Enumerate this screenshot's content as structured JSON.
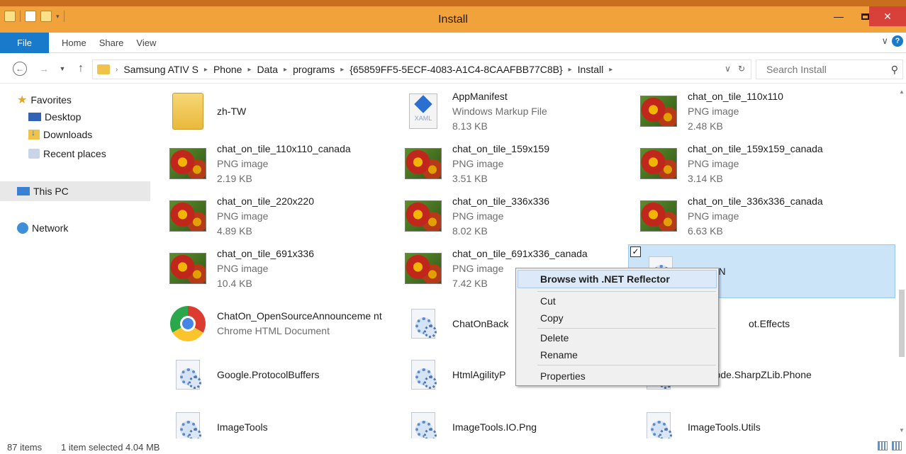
{
  "window": {
    "title": "Install"
  },
  "ribbon": {
    "tabs": [
      "File",
      "Home",
      "Share",
      "View"
    ]
  },
  "address": {
    "crumbs": [
      "Samsung ATIV S",
      "Phone",
      "Data",
      "programs",
      "{65859FF5-5ECF-4083-A1C4-8CAAFBB77C8B}",
      "Install"
    ],
    "search_placeholder": "Search Install"
  },
  "nav": {
    "favorites": "Favorites",
    "desktop": "Desktop",
    "downloads": "Downloads",
    "recent": "Recent places",
    "this_pc": "This PC",
    "network": "Network"
  },
  "files": [
    {
      "name": "zh-TW",
      "type": "",
      "size": "",
      "icon": "folder-icon"
    },
    {
      "name": "AppManifest",
      "type": "Windows Markup File",
      "size": "8.13 KB",
      "icon": "xaml-file-icon"
    },
    {
      "name": "chat_on_tile_110x110",
      "type": "PNG image",
      "size": "2.48 KB",
      "icon": "png-image-icon"
    },
    {
      "name": "chat_on_tile_110x110_canada",
      "type": "PNG image",
      "size": "2.19 KB",
      "icon": "png-image-icon"
    },
    {
      "name": "chat_on_tile_159x159",
      "type": "PNG image",
      "size": "3.51 KB",
      "icon": "png-image-icon"
    },
    {
      "name": "chat_on_tile_159x159_canada",
      "type": "PNG image",
      "size": "3.14 KB",
      "icon": "png-image-icon"
    },
    {
      "name": "chat_on_tile_220x220",
      "type": "PNG image",
      "size": "4.89 KB",
      "icon": "png-image-icon"
    },
    {
      "name": "chat_on_tile_336x336",
      "type": "PNG image",
      "size": "8.02 KB",
      "icon": "png-image-icon"
    },
    {
      "name": "chat_on_tile_336x336_canada",
      "type": "PNG image",
      "size": "6.63 KB",
      "icon": "png-image-icon"
    },
    {
      "name": "chat_on_tile_691x336",
      "type": "PNG image",
      "size": "10.4 KB",
      "icon": "png-image-icon"
    },
    {
      "name": "chat_on_tile_691x336_canada",
      "type": "PNG image",
      "size": "7.42 KB",
      "icon": "png-image-icon"
    },
    {
      "name": "ChatON",
      "type": "",
      "size": "",
      "icon": "dll-file-icon"
    },
    {
      "name": "ChatOn_OpenSourceAnnounceme nt",
      "type": "Chrome HTML Document",
      "size": "",
      "icon": "chrome-document-icon"
    },
    {
      "name": "ChatOnBack",
      "type": "",
      "size": "",
      "icon": "dll-file-icon"
    },
    {
      "name": "ot.Effects",
      "type": "",
      "size": "",
      "icon": "dll-file-icon"
    },
    {
      "name": "Google.ProtocolBuffers",
      "type": "",
      "size": "",
      "icon": "dll-file-icon"
    },
    {
      "name": "HtmlAgilityP",
      "type": "",
      "size": "",
      "icon": "dll-file-icon"
    },
    {
      "name": "rpCode.SharpZLib.Phone",
      "type": "",
      "size": "",
      "icon": "dll-file-icon"
    },
    {
      "name": "ImageTools",
      "type": "",
      "size": "",
      "icon": "dll-file-icon"
    },
    {
      "name": "ImageTools.IO.Png",
      "type": "",
      "size": "",
      "icon": "dll-file-icon"
    },
    {
      "name": "ImageTools.Utils",
      "type": "",
      "size": "",
      "icon": "dll-file-icon"
    }
  ],
  "context_menu": {
    "items": [
      "Browse with .NET Reflector",
      "Cut",
      "Copy",
      "Delete",
      "Rename",
      "Properties"
    ]
  },
  "status": {
    "count": "87 items",
    "selection": "1 item selected  4.04 MB"
  },
  "colors": {
    "titlebar": "#f2a23a",
    "file_tab": "#1979ca",
    "selection": "#cce4f7",
    "close_button": "#d8403a"
  }
}
